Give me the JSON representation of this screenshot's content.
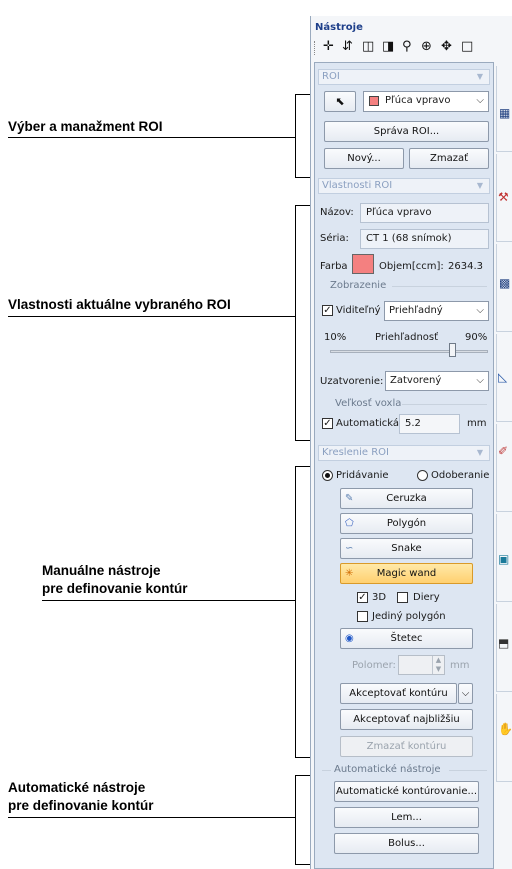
{
  "callouts": [
    {
      "line1": "Výber a manažment ROI",
      "line2": ""
    },
    {
      "line1": "Vlastnosti aktuálne vybraného ROI",
      "line2": ""
    },
    {
      "line1": "Manuálne nástroje",
      "line2": "pre definovanie kontúr"
    },
    {
      "line1": "Automatické nástroje",
      "line2": "pre definovanie kontúr"
    }
  ],
  "panel": {
    "title": "Nástroje",
    "toolbar_icons": [
      "crosshair-icon",
      "move-slice-icon",
      "layers-icon",
      "contrast-icon",
      "zoom-icon",
      "zoom-region-icon",
      "pan-icon",
      "fit-window-icon"
    ]
  },
  "roi": {
    "section_title": "ROI",
    "select_value": "Pľúca vpravo",
    "select_color": "#f48080",
    "manage_btn": "Správa ROI...",
    "new_btn": "Nový...",
    "delete_btn": "Zmazať"
  },
  "props": {
    "section_title": "Vlastnosti ROI",
    "name_label": "Názov:",
    "name_value": "Pľúca vpravo",
    "series_label": "Séria:",
    "series_value": "CT 1 (68 snímok)",
    "color_label": "Farba",
    "color_value": "#f48080",
    "volume_label": "Objem[ccm]:",
    "volume_value": "2634.3",
    "display_group": "Zobrazenie",
    "visible_label": "Viditeľný",
    "visible_checked": true,
    "display_mode": "Priehľadný",
    "opacity_min": "10%",
    "opacity_label": "Priehľadnosť",
    "opacity_max": "90%",
    "opacity_value": 0.78,
    "closure_label": "Uzatvorenie:",
    "closure_value": "Zatvorený",
    "voxel_group": "Veľkosť voxla",
    "auto_label": "Automatická",
    "auto_checked": true,
    "voxel_value": "5.2",
    "voxel_unit": "mm"
  },
  "draw": {
    "section_title": "Kreslenie ROI",
    "add_label": "Pridávanie",
    "remove_label": "Odoberanie",
    "mode_selected": "add",
    "tools": [
      "Ceruzka",
      "Polygón",
      "Snake",
      "Magic wand"
    ],
    "tool_icons": [
      "pencil-icon",
      "polygon-icon",
      "snake-icon",
      "magic-wand-icon"
    ],
    "active_tool": "Magic wand",
    "opt_3d": "3D",
    "opt_3d_checked": true,
    "opt_holes": "Diery",
    "opt_holes_checked": false,
    "opt_single": "Jediný polygón",
    "opt_single_checked": false,
    "brush_label": "Štetec",
    "radius_label": "Polomer:",
    "radius_unit": "mm",
    "accept_btn": "Akceptovať kontúru",
    "accept_nearest_btn": "Akceptovať najbližšiu",
    "delete_contour_btn": "Zmazať kontúru"
  },
  "auto": {
    "group_title": "Automatické nástroje",
    "autocontour_btn": "Automatické kontúrovanie...",
    "lem_btn": "Lem...",
    "bolus_btn": "Bolus..."
  },
  "side_tabs": [
    "grid-icon",
    "tools-icon",
    "layout-icon",
    "chart-icon",
    "brush-icon",
    "image-icon",
    "cube-icon",
    "hand-icon"
  ]
}
